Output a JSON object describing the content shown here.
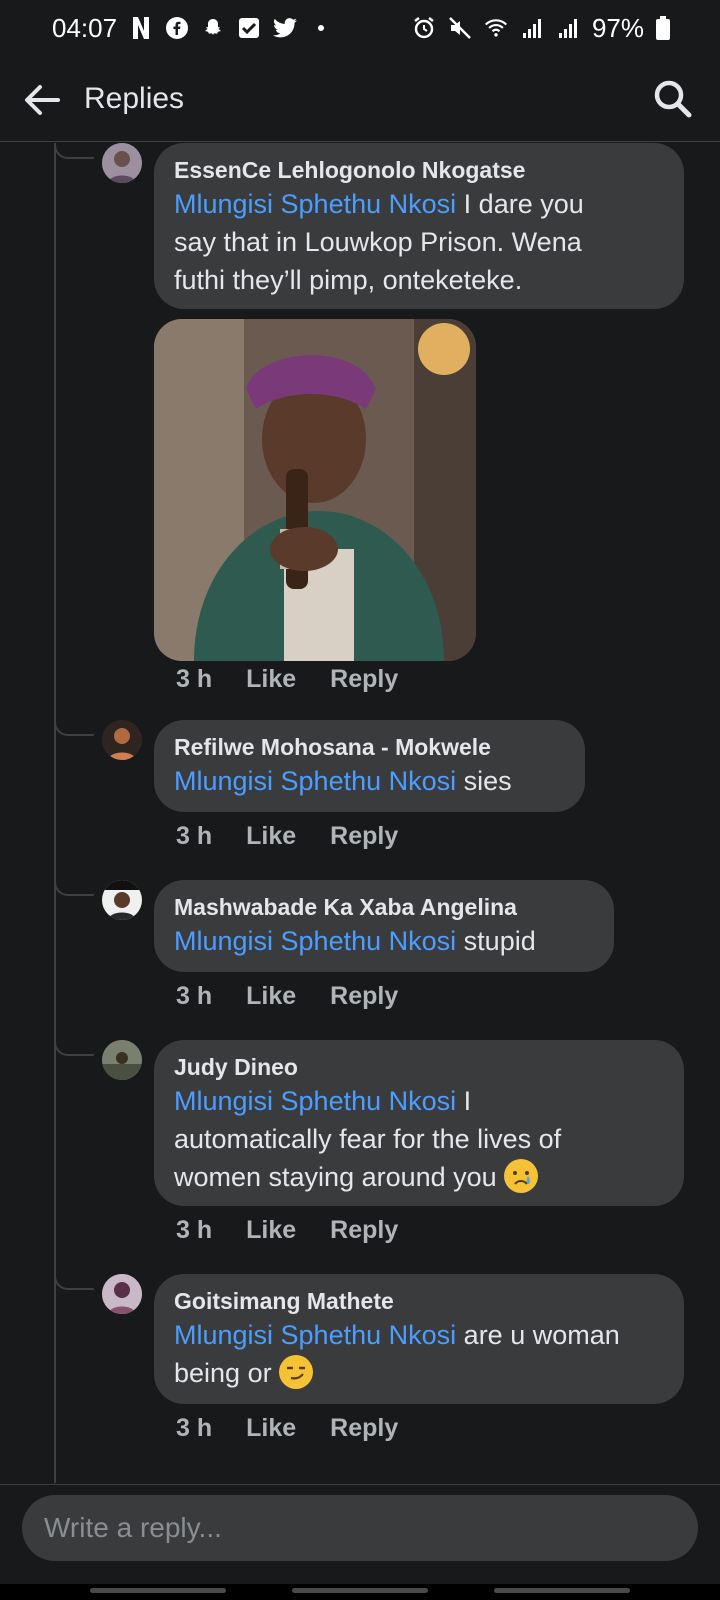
{
  "status_bar": {
    "time": "04:07",
    "battery": "97%"
  },
  "header": {
    "title": "Replies"
  },
  "comments": [
    {
      "author": "EssenCe Lehlogonolo Nkogatse",
      "mention": "Mlungisi Sphethu Nkosi",
      "text_lines": [
        "I dare you",
        "say that in Louwkop Prison. Wena",
        "futhi they’ll pimp, onteketeke."
      ],
      "has_photo": true,
      "time": "3 h",
      "like": "Like",
      "reply": "Reply"
    },
    {
      "author": "Refilwe Mohosana - Mokwele",
      "mention": "Mlungisi Sphethu Nkosi",
      "text": "sies",
      "time": "3 h",
      "like": "Like",
      "reply": "Reply"
    },
    {
      "author": "Mashwabade Ka Xaba Angelina",
      "mention": "Mlungisi Sphethu Nkosi",
      "text": "stupid",
      "time": "3 h",
      "like": "Like",
      "reply": "Reply"
    },
    {
      "author": "Judy Dineo",
      "mention": "Mlungisi Sphethu Nkosi",
      "text_lines": [
        "I",
        "automatically fear for the lives of",
        "women staying around you"
      ],
      "emoji": "crying-face",
      "time": "3 h",
      "like": "Like",
      "reply": "Reply"
    },
    {
      "author": "Goitsimang Mathete",
      "mention": "Mlungisi Sphethu Nkosi",
      "text_lines": [
        "are u woman",
        "being or"
      ],
      "emoji": "smirking-face",
      "time": "3 h",
      "like": "Like",
      "reply": "Reply"
    }
  ],
  "composer": {
    "placeholder": "Write a reply..."
  },
  "colors": {
    "background": "#18191a",
    "bubble": "#3a3b3c",
    "mention": "#4b9eff",
    "secondary_text": "#b0b3b8"
  }
}
